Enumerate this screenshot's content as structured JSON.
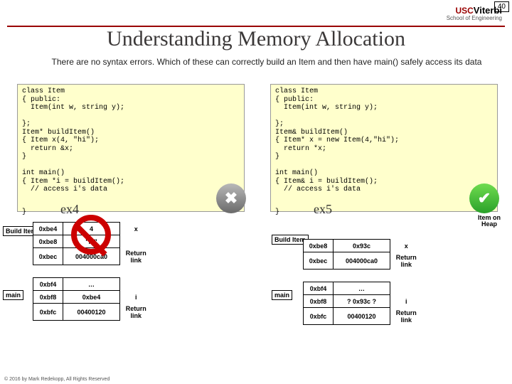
{
  "page_number": "40",
  "logo": {
    "usc": "USC",
    "viterbi": "Viterbi",
    "sub": "School of Engineering"
  },
  "title": "Understanding Memory Allocation",
  "subtitle": "There are no syntax errors.  Which of these can correctly build an Item and then have main() safely access its data",
  "code_left": "class Item\n{ public:\n  Item(int w, string y);\n\n};\nItem* buildItem()\n{ Item x(4, \"hi\");\n  return &x;\n}\n\nint main()\n{ Item *i = buildItem();\n  // access i's data\n\n}        ",
  "ex4": "ex4",
  "code_right": "class Item\n{ public:\n  Item(int w, string y);\n\n};\nItem& buildItem()\n{ Item* x = new Item(4,\"hi\");\n  return *x;\n}\n\nint main()\n{ Item& i = buildItem();\n  // access i's data\n\n}        ",
  "ex5": "ex5",
  "left_stack": {
    "build_label": "Build\nItem",
    "main_label": "main",
    "rows": [
      {
        "addr": "0xbe4",
        "val": "4",
        "lbl": "x"
      },
      {
        "addr": "0xbe8",
        "val": "\"hi\"",
        "lbl": ""
      },
      {
        "addr": "0xbec",
        "val": "004000ca0",
        "lbl": "Return link"
      },
      {
        "addr": "0xbf4",
        "val": "…",
        "lbl": ""
      },
      {
        "addr": "0xbf8",
        "val": "0xbe4",
        "lbl": "i"
      },
      {
        "addr": "0xbfc",
        "val": "00400120",
        "lbl": "Return link"
      }
    ]
  },
  "right_stack": {
    "build_label": "Build\nItem",
    "main_label": "main",
    "heap_label": "Item\non\nHeap",
    "rows_heap": [
      {
        "addr": "0xbe8",
        "val": "0x93c",
        "lbl": "x"
      },
      {
        "addr": "0xbec",
        "val": "004000ca0",
        "lbl": "Return link"
      }
    ],
    "rows_main": [
      {
        "addr": "0xbf4",
        "val": "…",
        "lbl": ""
      },
      {
        "addr": "0xbf8",
        "val": "? 0x93c ?",
        "lbl": "i"
      },
      {
        "addr": "0xbfc",
        "val": "00400120",
        "lbl": "Return link"
      }
    ]
  },
  "copyright": "© 2016 by Mark Redekopp, All Rights Reserved"
}
